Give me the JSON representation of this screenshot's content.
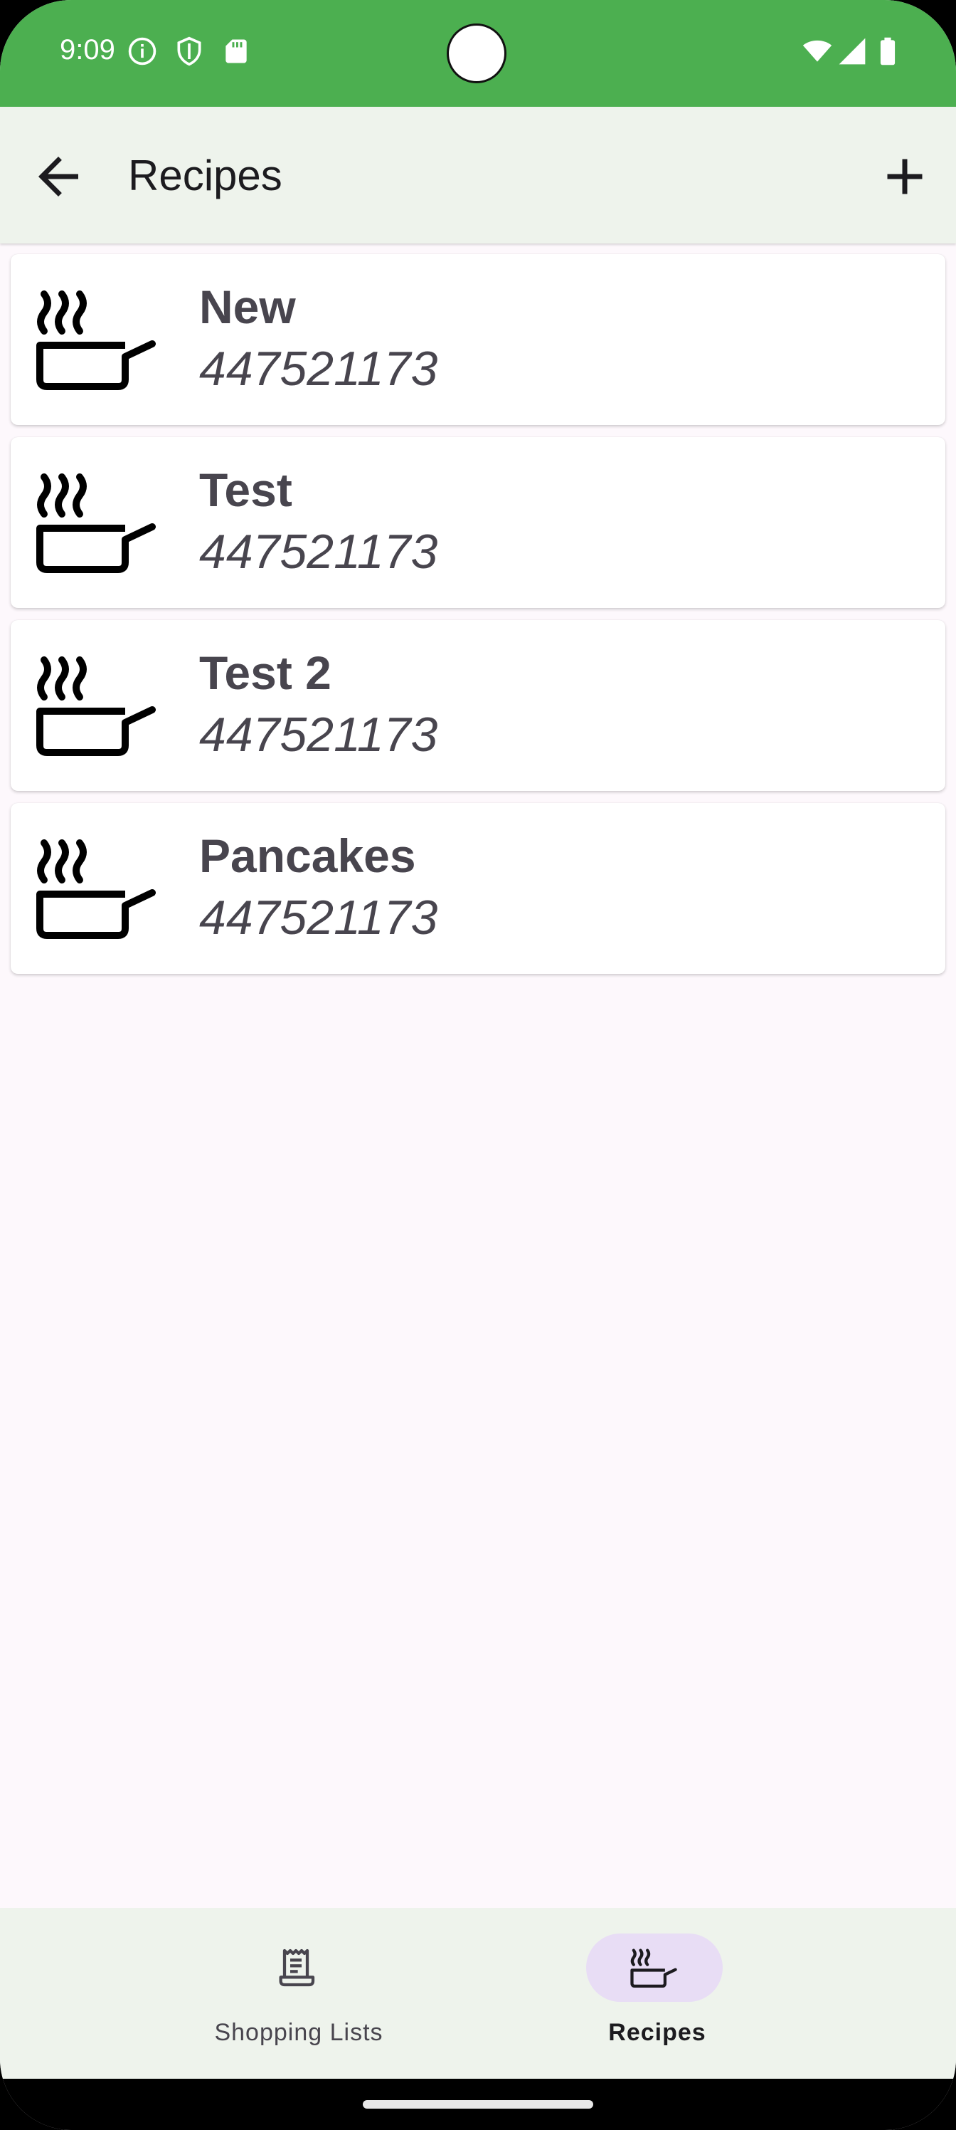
{
  "status_bar": {
    "time": "9:09",
    "icons_left": [
      "info-icon",
      "shield-icon",
      "sd-card-icon"
    ],
    "icons_right": [
      "wifi-icon",
      "cellular-signal-icon",
      "battery-icon"
    ],
    "background_color": "#4caf50"
  },
  "app_bar": {
    "title": "Recipes",
    "back_icon": "arrow-back-icon",
    "action_icon": "add-icon"
  },
  "recipes": [
    {
      "title": "New",
      "subtitle": "447521173",
      "icon": "cooking-pot-icon"
    },
    {
      "title": "Test",
      "subtitle": "447521173",
      "icon": "cooking-pot-icon"
    },
    {
      "title": "Test 2",
      "subtitle": "447521173",
      "icon": "cooking-pot-icon"
    },
    {
      "title": "Pancakes",
      "subtitle": "447521173",
      "icon": "cooking-pot-icon"
    }
  ],
  "bottom_nav": {
    "items": [
      {
        "label": "Shopping Lists",
        "icon": "receipt-icon",
        "selected": false
      },
      {
        "label": "Recipes",
        "icon": "cooking-pot-icon",
        "selected": true
      }
    ],
    "active_indicator_color": "#e8ddf5"
  }
}
